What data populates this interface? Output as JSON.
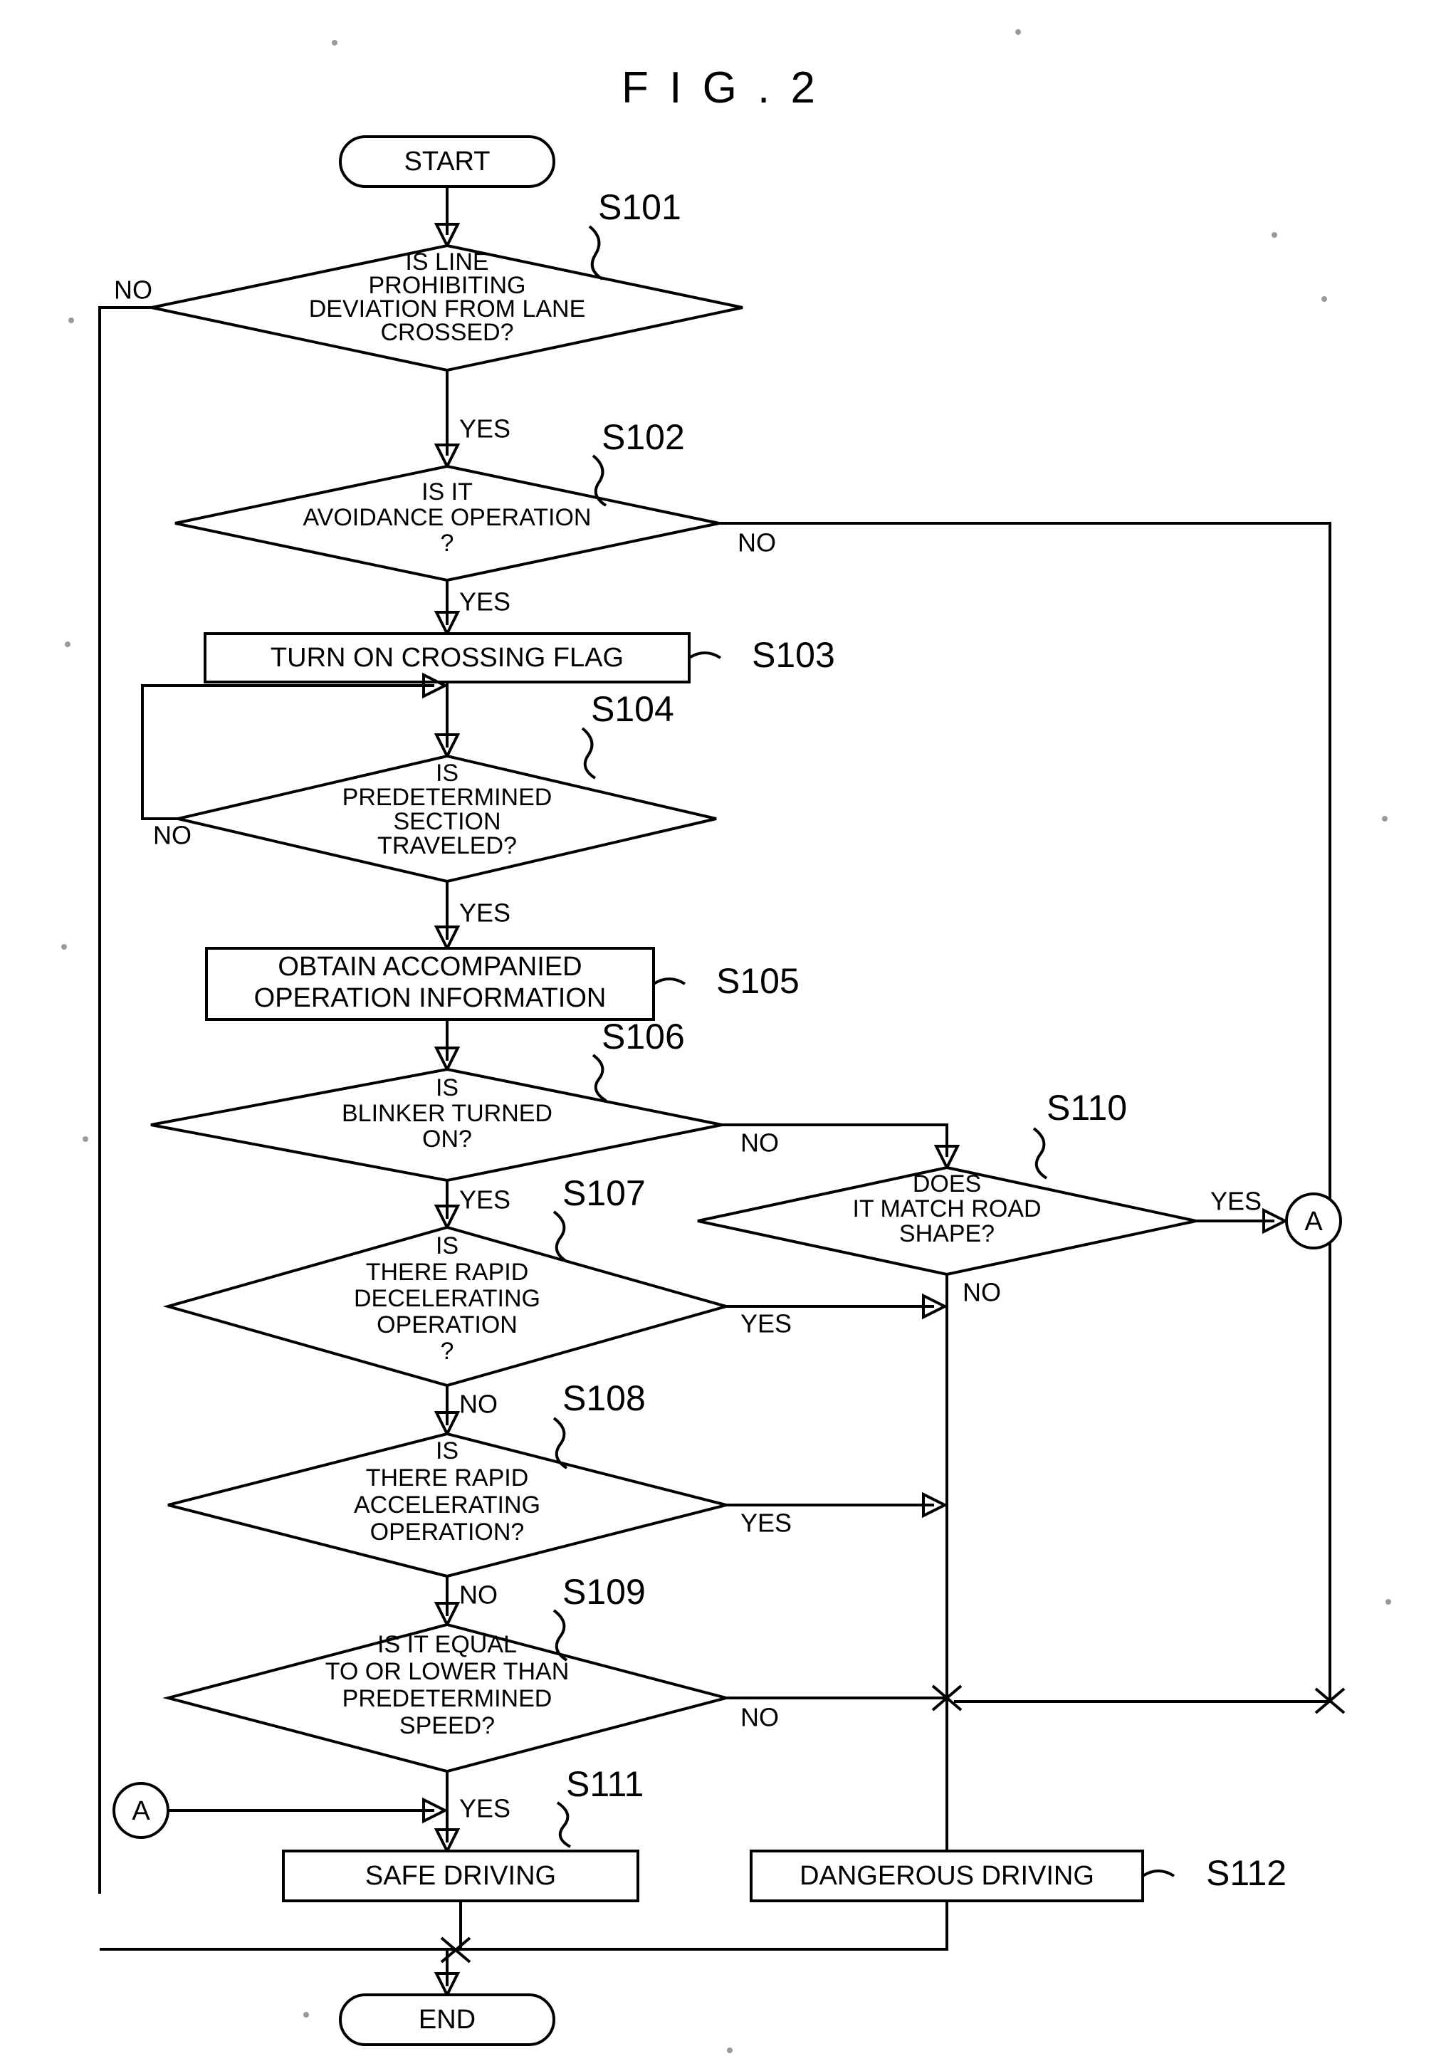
{
  "figure": {
    "title": "F I G . 2"
  },
  "nodes": {
    "start": {
      "label": "START"
    },
    "end": {
      "label": "END"
    },
    "s101": {
      "step": "S101",
      "lines": [
        "IS LINE",
        "PROHIBITING",
        "DEVIATION FROM LANE",
        "CROSSED?"
      ],
      "yes": "YES",
      "no": "NO"
    },
    "s102": {
      "step": "S102",
      "lines": [
        "IS IT",
        "AVOIDANCE OPERATION",
        "?"
      ],
      "yes": "YES",
      "no": "NO"
    },
    "s103": {
      "step": "S103",
      "lines": [
        "TURN ON CROSSING FLAG"
      ]
    },
    "s104": {
      "step": "S104",
      "lines": [
        "IS",
        "PREDETERMINED",
        "SECTION",
        "TRAVELED?"
      ],
      "yes": "YES",
      "no": "NO"
    },
    "s105": {
      "step": "S105",
      "lines": [
        "OBTAIN ACCOMPANIED",
        "OPERATION INFORMATION"
      ]
    },
    "s106": {
      "step": "S106",
      "lines": [
        "IS",
        "BLINKER TURNED",
        "ON?"
      ],
      "yes": "YES",
      "no": "NO"
    },
    "s107": {
      "step": "S107",
      "lines": [
        "IS",
        "THERE RAPID",
        "DECELERATING",
        "OPERATION",
        "?"
      ],
      "yes": "YES",
      "no": "NO"
    },
    "s108": {
      "step": "S108",
      "lines": [
        "IS",
        "THERE RAPID",
        "ACCELERATING",
        "OPERATION?"
      ],
      "yes": "YES",
      "no": "NO"
    },
    "s109": {
      "step": "S109",
      "lines": [
        "IS IT EQUAL",
        "TO OR LOWER THAN",
        "PREDETERMINED",
        "SPEED?"
      ],
      "yes": "YES",
      "no": "NO"
    },
    "s110": {
      "step": "S110",
      "lines": [
        "DOES",
        "IT MATCH ROAD",
        "SHAPE?"
      ],
      "yes": "YES",
      "no": "NO"
    },
    "s111": {
      "step": "S111",
      "lines": [
        "SAFE DRIVING"
      ]
    },
    "s112": {
      "step": "S112",
      "lines": [
        "DANGEROUS DRIVING"
      ]
    },
    "connector_a_right": {
      "label": "A"
    },
    "connector_a_left": {
      "label": "A"
    }
  }
}
